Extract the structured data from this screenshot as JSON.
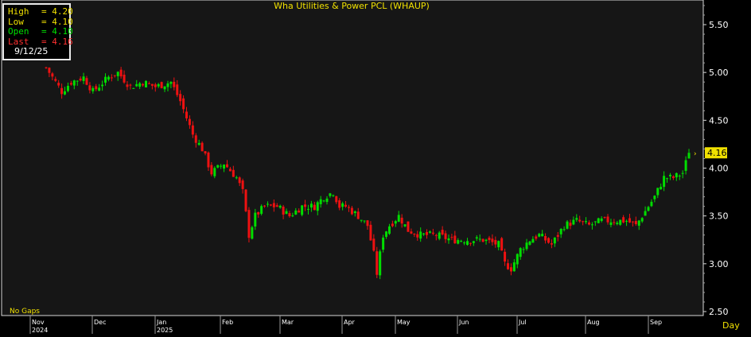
{
  "title": "Wha Utilities & Power PCL (WHAUP)",
  "ohlc_box": {
    "rows": [
      {
        "label": "High",
        "value": "4.20",
        "color": "#f0e000"
      },
      {
        "label": "Low",
        "value": "4.10",
        "color": "#f0e000"
      },
      {
        "label": "Open",
        "value": "4.10",
        "color": "#00e000"
      },
      {
        "label": "Last",
        "value": "4.16",
        "color": "#ff3030"
      }
    ],
    "date": "9/12/25"
  },
  "footer": {
    "gaps_label": "No Gaps",
    "period_label": "Day"
  },
  "last_price_tag": "4.16",
  "colors": {
    "up": "#00dd00",
    "down": "#ee1111",
    "grid": "#000000",
    "axis_text": "#ffffff",
    "title": "#f0e000"
  },
  "chart_data": {
    "type": "candlestick",
    "title": "Wha Utilities & Power PCL (WHAUP)",
    "ylim": [
      2.5,
      5.75
    ],
    "y_ticks": [
      "2.50",
      "3.00",
      "3.50",
      "4.00",
      "4.50",
      "5.00",
      "5.50"
    ],
    "months": [
      {
        "label": "Nov",
        "year": "2024",
        "day_index": 0
      },
      {
        "label": "Dec",
        "year": "",
        "day_index": 20
      },
      {
        "label": "Jan",
        "year": "2025",
        "day_index": 40
      },
      {
        "label": "Feb",
        "year": "",
        "day_index": 61
      },
      {
        "label": "Mar",
        "year": "",
        "day_index": 80
      },
      {
        "label": "Apr",
        "year": "",
        "day_index": 100
      },
      {
        "label": "May",
        "year": "",
        "day_index": 117
      },
      {
        "label": "Jun",
        "year": "",
        "day_index": 137
      },
      {
        "label": "Jul",
        "year": "",
        "day_index": 156
      },
      {
        "label": "Aug",
        "year": "",
        "day_index": 178
      },
      {
        "label": "Sep",
        "year": "",
        "day_index": 198
      }
    ],
    "total_days": 206,
    "path": [
      [
        0,
        5.05
      ],
      [
        5,
        4.8
      ],
      [
        8,
        4.9
      ],
      [
        12,
        4.95
      ],
      [
        15,
        4.8
      ],
      [
        20,
        4.95
      ],
      [
        23,
        5.0
      ],
      [
        27,
        4.85
      ],
      [
        31,
        4.9
      ],
      [
        35,
        4.85
      ],
      [
        40,
        4.9
      ],
      [
        43,
        4.7
      ],
      [
        47,
        4.35
      ],
      [
        50,
        4.2
      ],
      [
        53,
        3.95
      ],
      [
        57,
        4.05
      ],
      [
        61,
        3.9
      ],
      [
        63,
        3.75
      ],
      [
        65,
        3.3
      ],
      [
        67,
        3.5
      ],
      [
        70,
        3.6
      ],
      [
        74,
        3.6
      ],
      [
        78,
        3.5
      ],
      [
        82,
        3.6
      ],
      [
        86,
        3.6
      ],
      [
        89,
        3.7
      ],
      [
        92,
        3.75
      ],
      [
        94,
        3.6
      ],
      [
        96,
        3.6
      ],
      [
        100,
        3.5
      ],
      [
        103,
        3.4
      ],
      [
        105,
        3.1
      ],
      [
        106,
        2.9
      ],
      [
        108,
        3.3
      ],
      [
        110,
        3.4
      ],
      [
        113,
        3.5
      ],
      [
        116,
        3.35
      ],
      [
        120,
        3.3
      ],
      [
        125,
        3.3
      ],
      [
        130,
        3.25
      ],
      [
        135,
        3.25
      ],
      [
        140,
        3.25
      ],
      [
        145,
        3.2
      ],
      [
        147,
        3.0
      ],
      [
        149,
        2.95
      ],
      [
        152,
        3.15
      ],
      [
        155,
        3.25
      ],
      [
        158,
        3.3
      ],
      [
        162,
        3.2
      ],
      [
        166,
        3.4
      ],
      [
        170,
        3.45
      ],
      [
        174,
        3.4
      ],
      [
        178,
        3.45
      ],
      [
        182,
        3.45
      ],
      [
        186,
        3.45
      ],
      [
        189,
        3.4
      ],
      [
        192,
        3.55
      ],
      [
        195,
        3.7
      ],
      [
        198,
        3.9
      ],
      [
        201,
        3.9
      ],
      [
        204,
        3.95
      ],
      [
        206,
        4.16
      ]
    ],
    "last": {
      "date": "9/12/25",
      "open": 4.1,
      "high": 4.2,
      "low": 4.1,
      "close": 4.16
    }
  }
}
